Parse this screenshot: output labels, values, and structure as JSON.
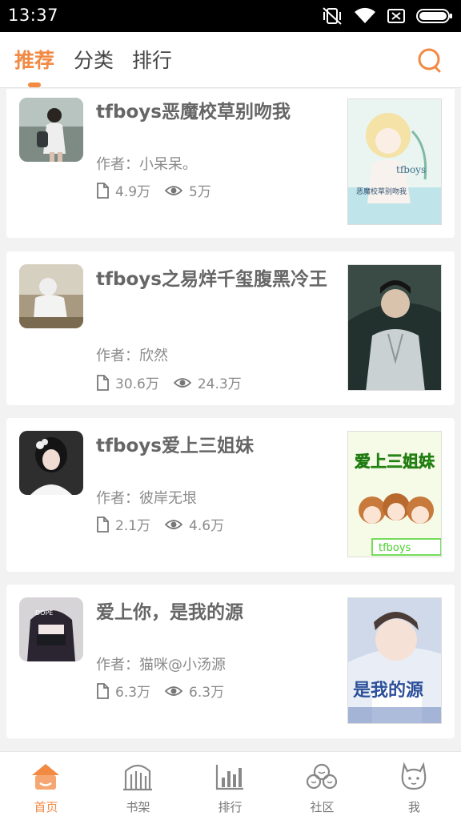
{
  "status_bar": {
    "time": "13:37"
  },
  "top_tabs": [
    {
      "label": "推荐",
      "active": true
    },
    {
      "label": "分类",
      "active": false
    },
    {
      "label": "排行",
      "active": false
    }
  ],
  "accent_color": "#f28a44",
  "books": [
    {
      "title": "tfboys恶魔校草别吻我",
      "author": "作者：小呆呆。",
      "words": "4.9万",
      "views": "5万",
      "cover_text": "恶魔校草别吻我"
    },
    {
      "title": "tfboys之易烊千玺腹黑冷王",
      "author": "作者：欣然",
      "words": "30.6万",
      "views": "24.3万",
      "cover_text": ""
    },
    {
      "title": "tfboys爱上三姐妹",
      "author": "作者：彼岸无垠",
      "words": "2.1万",
      "views": "4.6万",
      "cover_text": "爱上三姐妹"
    },
    {
      "title": "爱上你，是我的源",
      "author": "作者：猫咪@小汤源",
      "words": "6.3万",
      "views": "6.3万",
      "cover_text": "是我的源"
    }
  ],
  "bottom_nav": [
    {
      "label": "首页",
      "icon": "home-icon",
      "active": true
    },
    {
      "label": "书架",
      "icon": "bookshelf-icon",
      "active": false
    },
    {
      "label": "排行",
      "icon": "ranking-icon",
      "active": false
    },
    {
      "label": "社区",
      "icon": "community-icon",
      "active": false
    },
    {
      "label": "我",
      "icon": "profile-icon",
      "active": false
    }
  ]
}
